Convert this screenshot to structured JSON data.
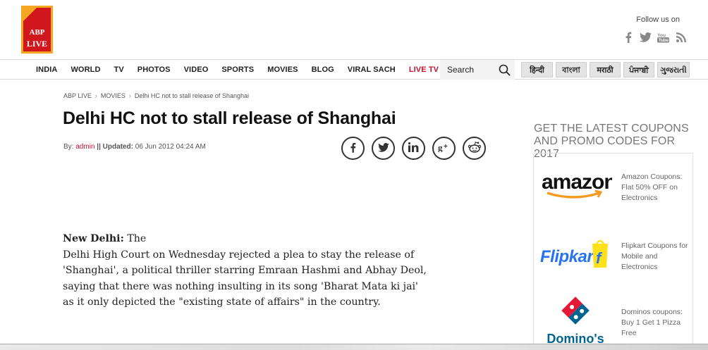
{
  "header": {
    "logo_top": "ABP",
    "logo_bottom": "LIVE",
    "follow_label": "Follow us on",
    "social": [
      "facebook-icon",
      "twitter-icon",
      "youtube-icon",
      "rss-icon"
    ]
  },
  "nav": {
    "items": [
      "INDIA",
      "WORLD",
      "TV",
      "PHOTOS",
      "VIDEO",
      "SPORTS",
      "MOVIES",
      "BLOG",
      "VIRAL SACH",
      "LIVE TV"
    ],
    "more": "•••",
    "search_placeholder": "Search",
    "languages": [
      "हिन्दी",
      "বাংলা",
      "मराठी",
      "ਪੰਜਾਬੀ",
      "ગુજરાતી"
    ]
  },
  "breadcrumb": [
    "ABP LIVE",
    "MOVIES",
    "Delhi HC not to stall release of Shanghai"
  ],
  "article": {
    "title": "Delhi HC not to stall release of Shanghai",
    "by_label": "By:",
    "author": "admin",
    "updated_label": "|| Updated:",
    "updated": "06 Jun 2012 04:24 AM",
    "place": "New Delhi:",
    "lead": "The",
    "body": "Delhi High Court on Wednesday rejected a plea to stay the release of 'Shanghai', a political thriller starring Emraan Hashmi and Abhay Deol, saying that there was nothing insulting in its song 'Bharat Mata ki jai' as it only depicted the \"existing state of affairs\" in the country."
  },
  "share": [
    "facebook-icon",
    "twitter-icon",
    "linkedin-icon",
    "google-plus-icon",
    "reddit-icon"
  ],
  "sidebar": {
    "title": "GET THE LATEST COUPONS AND PROMO CODES FOR 2017",
    "coupons": [
      {
        "brand": "amazon",
        "text": "Amazon Coupons: Flat 50% OFF on Electronics"
      },
      {
        "brand": "Flipkart",
        "text": "Flipkart Coupons for Mobile and Electronics"
      },
      {
        "brand": "Domino's",
        "text": "Dominos coupons: Buy 1 Get 1 Pizza Free"
      }
    ]
  },
  "colors": {
    "brand_red": "#c8102e",
    "logo_orange": "#f5a623"
  }
}
